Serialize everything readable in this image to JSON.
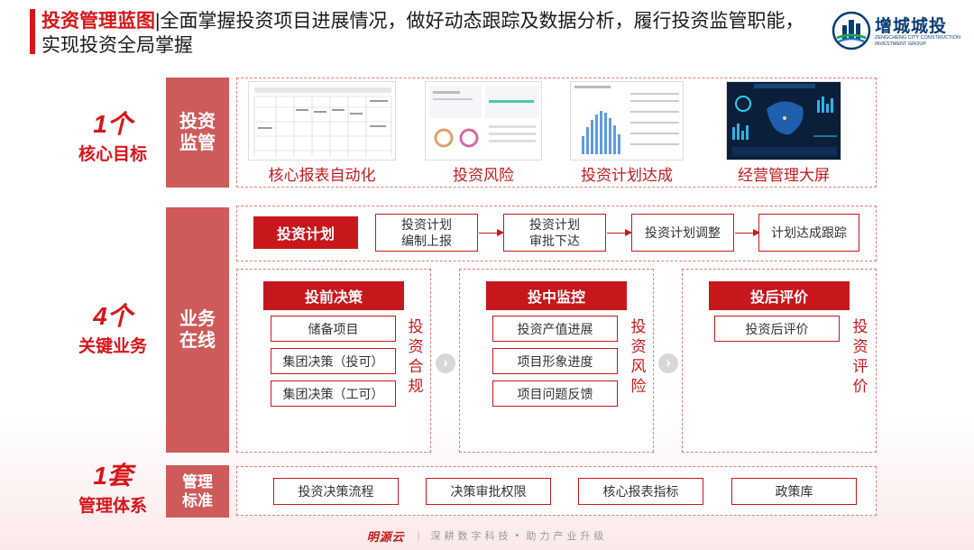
{
  "header": {
    "title_highlight": "投资管理蓝图",
    "title_sep": "|",
    "title_text": "全面掌握投资项目进展情况，做好动态跟踪及数据分析，履行投资监管职能，实现投资全局掌握"
  },
  "logo": {
    "name_cn": "增城城投",
    "name_en": "ZENGCHENG CITY CONSTRUCTION INVESTMENT GROUP"
  },
  "sections": {
    "s1": {
      "num": "1个",
      "label": "核心目标",
      "block_line1": "投资",
      "block_line2": "监管"
    },
    "s2": {
      "num": "4个",
      "label": "关键业务",
      "block_line1": "业务",
      "block_line2": "在线"
    },
    "s3": {
      "num": "1套",
      "label": "管理体系",
      "block_line1": "管理",
      "block_line2": "标准"
    }
  },
  "supervision": {
    "items": [
      "核心报表自动化",
      "投资风险",
      "投资计划达成",
      "经营管理大屏"
    ]
  },
  "plan": {
    "title": "投资计划",
    "steps": [
      {
        "line1": "投资计划",
        "line2": "编制上报"
      },
      {
        "line1": "投资计划",
        "line2": "审批下达"
      },
      {
        "line1": "投资计划调整",
        "line2": ""
      },
      {
        "line1": "计划达成跟踪",
        "line2": ""
      }
    ]
  },
  "phases": [
    {
      "title": "投前决策",
      "items": [
        "储备项目",
        "集团决策（投可）",
        "集团决策（工可）"
      ],
      "side": [
        "投",
        "资",
        "合",
        "规"
      ]
    },
    {
      "title": "投中监控",
      "items": [
        "投资产值进展",
        "项目形象进度",
        "项目问题反馈"
      ],
      "side": [
        "投",
        "资",
        "风",
        "险"
      ]
    },
    {
      "title": "投后评价",
      "items": [
        "投资后评价"
      ],
      "side": [
        "投",
        "资",
        "评",
        "价"
      ]
    }
  ],
  "standards": {
    "items": [
      "投资决策流程",
      "决策审批权限",
      "核心报表指标",
      "政策库"
    ]
  },
  "footer": {
    "brand": "明源云",
    "slogan1": "深耕数字科技",
    "dot": "•",
    "slogan2": "助力产业升级"
  },
  "colors": {
    "accent": "#d9151b",
    "block": "#ce5a5a",
    "brand_blue": "#0a3d73"
  }
}
